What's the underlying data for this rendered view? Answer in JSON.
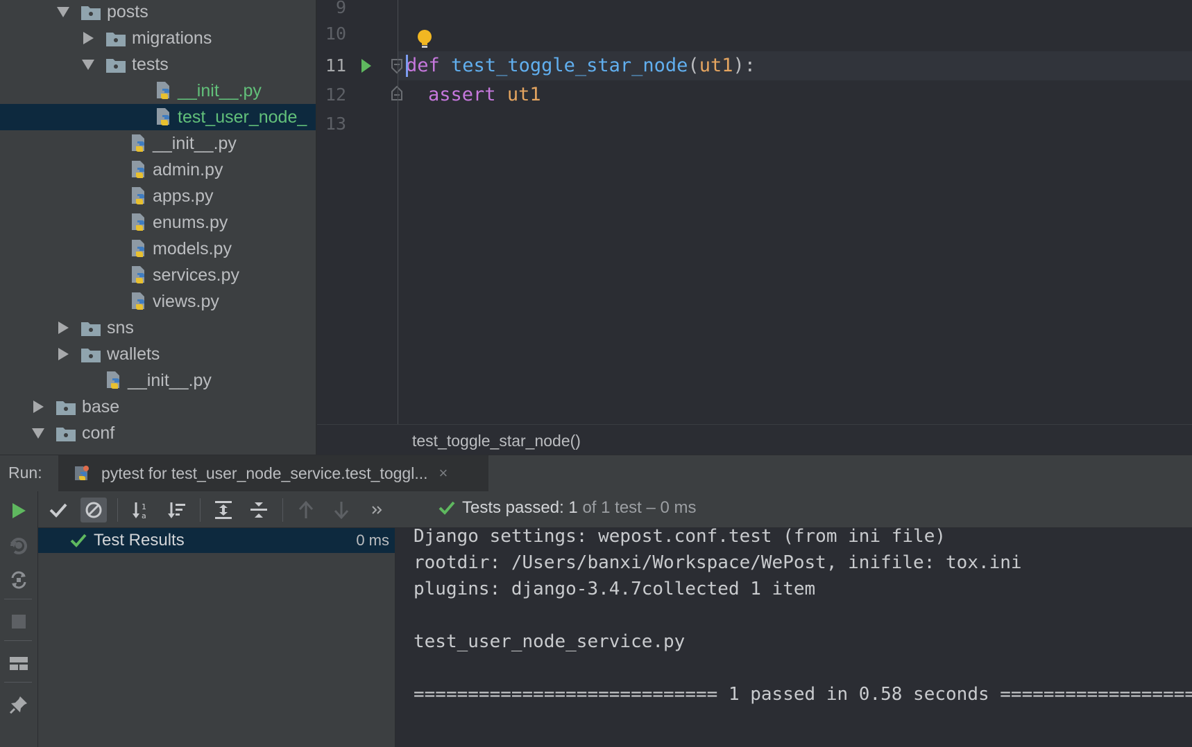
{
  "project_tree": {
    "items": [
      {
        "label": "posts",
        "type": "folder",
        "expanded": true,
        "depth": 3
      },
      {
        "label": "migrations",
        "type": "folder",
        "expanded": false,
        "depth": 4
      },
      {
        "label": "tests",
        "type": "folder",
        "expanded": true,
        "depth": 4
      },
      {
        "label": "__init__.py",
        "type": "py",
        "depth": 6,
        "status": "added"
      },
      {
        "label": "test_user_node_",
        "type": "py",
        "depth": 6,
        "status": "added",
        "selected": true
      },
      {
        "label": "__init__.py",
        "type": "py",
        "depth": 5
      },
      {
        "label": "admin.py",
        "type": "py",
        "depth": 5
      },
      {
        "label": "apps.py",
        "type": "py",
        "depth": 5
      },
      {
        "label": "enums.py",
        "type": "py",
        "depth": 5
      },
      {
        "label": "models.py",
        "type": "py",
        "depth": 5
      },
      {
        "label": "services.py",
        "type": "py",
        "depth": 5
      },
      {
        "label": "views.py",
        "type": "py",
        "depth": 5
      },
      {
        "label": "sns",
        "type": "folder",
        "expanded": false,
        "depth": 3
      },
      {
        "label": "wallets",
        "type": "folder",
        "expanded": false,
        "depth": 3
      },
      {
        "label": "__init__.py",
        "type": "py",
        "depth": 4
      },
      {
        "label": "base",
        "type": "folder",
        "expanded": false,
        "depth": 2
      },
      {
        "label": "conf",
        "type": "folder",
        "expanded": true,
        "depth": 2
      }
    ]
  },
  "editor": {
    "line_numbers": [
      "9",
      "10",
      "11",
      "12",
      "13"
    ],
    "current_line": "11",
    "code": {
      "line11": {
        "kw": "def",
        "fn": "test_toggle_star_node",
        "open": "(",
        "param": "ut1",
        "close": "):"
      },
      "line12": {
        "kw": "assert",
        "param": "ut1"
      }
    },
    "breadcrumb": "test_toggle_star_node()"
  },
  "run": {
    "label": "Run:",
    "tab_title": "pytest for test_user_node_service.test_toggl...",
    "tab_close": "×",
    "status": {
      "prefix": "Tests passed:",
      "count": "1",
      "suffix": "of 1 test – 0 ms"
    },
    "results": {
      "label": "Test Results",
      "time": "0 ms"
    },
    "console_lines": [
      "Django settings: wepost.conf.test (from ini file)",
      "rootdir: /Users/banxi/Workspace/WePost, inifile: tox.ini",
      "plugins: django-3.4.7collected 1 item",
      "",
      "test_user_node_service.py",
      "",
      "============================ 1 passed in 0.58 seconds ==================="
    ]
  },
  "colors": {
    "passed_green": "#5fb85f",
    "selection": "#0d293e",
    "keyword": "#c678dd",
    "function": "#61afef",
    "param": "#e5a560"
  }
}
